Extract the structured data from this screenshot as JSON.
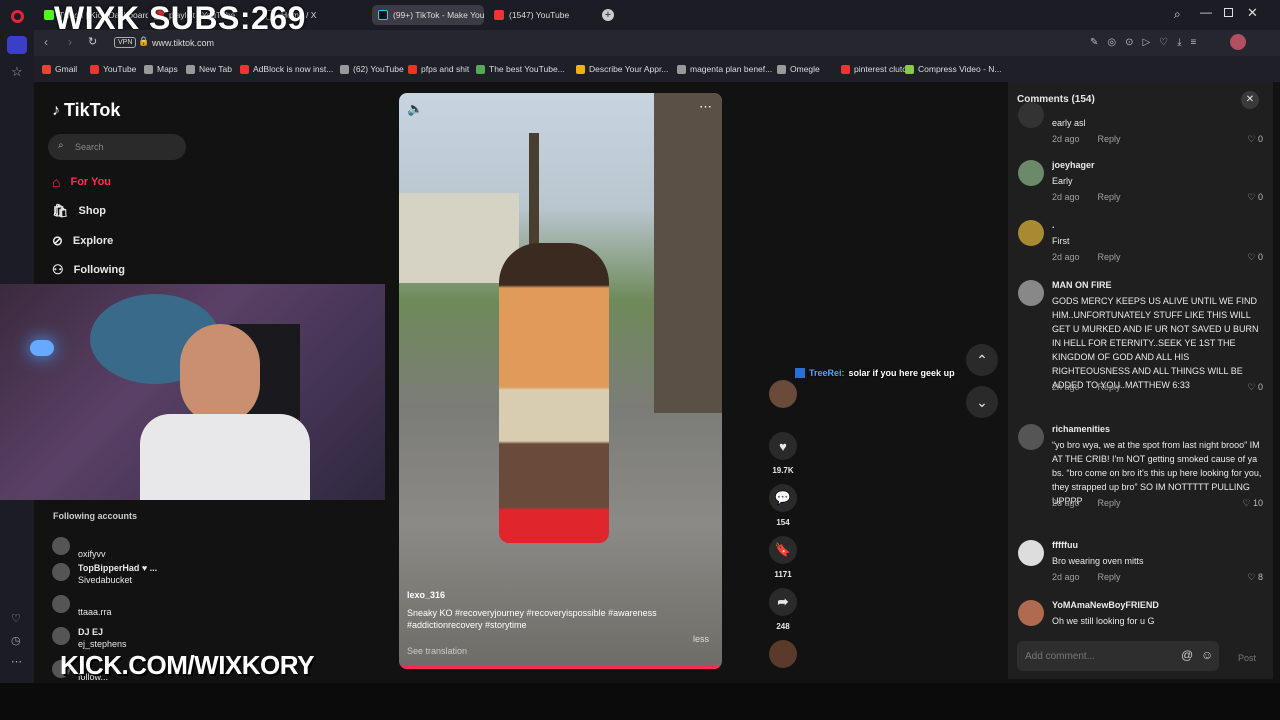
{
  "overlay": {
    "subs": "WIXK SUBS:269",
    "kick": "KICK.COM/WIXKORY"
  },
  "tabs": [
    {
      "label": "Twitch | Kick Dashboard"
    },
    {
      "label": "playlist | YouTube"
    },
    {
      "label": "Home / X"
    },
    {
      "label": "(99+) TikTok - Make Your Day"
    },
    {
      "label": "(1547) YouTube"
    }
  ],
  "address": {
    "vpn": "VPN",
    "url": "www.tiktok.com"
  },
  "bookmarks": [
    "Gmail",
    "YouTube",
    "Maps",
    "New Tab",
    "AdBlock is now inst...",
    "(62) YouTube",
    "pfps and shit",
    "The best YouTube...",
    "Describe Your Appr...",
    "magenta plan benef...",
    "Omegle",
    "pinterest clutch",
    "Compress Video - N..."
  ],
  "tiktok": {
    "logo": "TikTok",
    "search_placeholder": "Search",
    "nav": [
      {
        "label": "For You"
      },
      {
        "label": "Shop"
      },
      {
        "label": "Explore"
      },
      {
        "label": "Following"
      }
    ],
    "following_title": "Following accounts",
    "following": [
      {
        "name": "",
        "user": "oxifyvv"
      },
      {
        "name": "TopBipperHad ♥ ...",
        "user": "Sivedabucket"
      },
      {
        "name": "",
        "user": "ttaaa.rra"
      },
      {
        "name": "DJ EJ",
        "user": "ej_stephens"
      },
      {
        "name": "",
        "user": "follow..."
      }
    ]
  },
  "video": {
    "user": "lexo_316",
    "caption": "Sneaky KO #recoveryjourney #recoveryispossible #awareness #addictionrecovery #storytime",
    "less": "less",
    "see_translation": "See translation"
  },
  "actions": {
    "likes": "19.7K",
    "comments": "154",
    "saves": "1171",
    "shares": "248"
  },
  "chat": {
    "user": "TreeRei:",
    "text": "solar if you here geek up"
  },
  "comments_panel": {
    "title": "Comments (154)",
    "add_placeholder": "Add comment...",
    "post": "Post",
    "items": [
      {
        "name": "",
        "text": "early asl",
        "time": "2d ago",
        "likes": "0"
      },
      {
        "name": "joeyhager",
        "text": "Early",
        "time": "2d ago",
        "likes": "0"
      },
      {
        "name": ".",
        "text": "First",
        "time": "2d ago",
        "likes": "0"
      },
      {
        "name": "MAN ON FIRE",
        "text": "GODS MERCY KEEPS US ALIVE UNTIL WE FIND HIM..UNFORTUNATELY STUFF LIKE THIS WILL GET U MURKED AND IF UR NOT SAVED U BURN IN HELL FOR ETERNITY..SEEK YE 1ST THE KINGDOM OF GOD AND ALL HIS RIGHTEOUSNESS AND ALL THINGS WILL BE ADDED TO YOU..MATTHEW 6:33",
        "time": "2h ago",
        "likes": "0"
      },
      {
        "name": "richamenities",
        "text": "“yo bro wya, we at the spot from last night brooo” IM AT THE CRIB! I'm NOT getting smoked cause of ya bs. “bro come on bro it's this up here looking for you, they strapped up bro” SO IM NOTTTTT PULLING UPPPP",
        "time": "2d ago",
        "likes": "10"
      },
      {
        "name": "fffffuu",
        "text": "Bro wearing oven mitts",
        "time": "2d ago",
        "likes": "8"
      },
      {
        "name": "YoMAmaNewBoyFRIEND",
        "text": "Oh we still looking for u G",
        "time": "",
        "likes": ""
      }
    ],
    "reply": "Reply"
  }
}
